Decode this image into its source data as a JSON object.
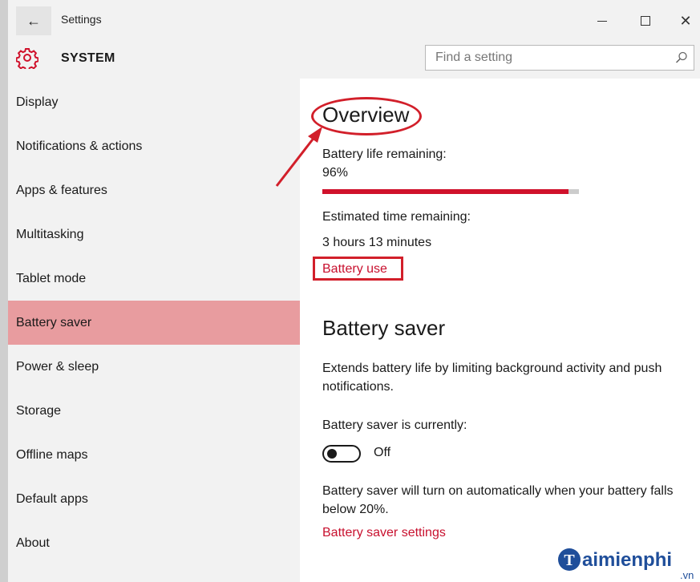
{
  "window": {
    "title": "Settings",
    "back_glyph": "←",
    "minimize_glyph": "—",
    "maximize_glyph": "□",
    "close_glyph": "✕"
  },
  "header": {
    "section_title": "SYSTEM",
    "search_placeholder": "Find a setting",
    "gear_icon": "gear-icon",
    "accent_color": "#d0112b"
  },
  "sidebar": {
    "items": [
      {
        "label": "Display"
      },
      {
        "label": "Notifications & actions"
      },
      {
        "label": "Apps & features"
      },
      {
        "label": "Multitasking"
      },
      {
        "label": "Tablet mode"
      },
      {
        "label": "Battery saver",
        "selected": true
      },
      {
        "label": "Power & sleep"
      },
      {
        "label": "Storage"
      },
      {
        "label": "Offline maps"
      },
      {
        "label": "Default apps"
      },
      {
        "label": "About"
      }
    ],
    "selected_color": "#e89c9f"
  },
  "overview": {
    "heading": "Overview",
    "battery_life_label": "Battery life remaining:",
    "battery_percent_text": "96%",
    "battery_level": 0.96,
    "estimated_label": "Estimated time remaining:",
    "estimated_value": "3 hours 13 minutes",
    "battery_use_link": "Battery use"
  },
  "battery_saver": {
    "heading": "Battery saver",
    "description": "Extends battery life by limiting background activity and push notifications.",
    "currently_label": "Battery saver is currently:",
    "toggle_state": "Off",
    "auto_description": "Battery saver will turn on automatically when your battery falls below 20%.",
    "settings_link": "Battery saver settings"
  },
  "watermark": {
    "brand": "aimienphi",
    "suffix": ".vn"
  }
}
